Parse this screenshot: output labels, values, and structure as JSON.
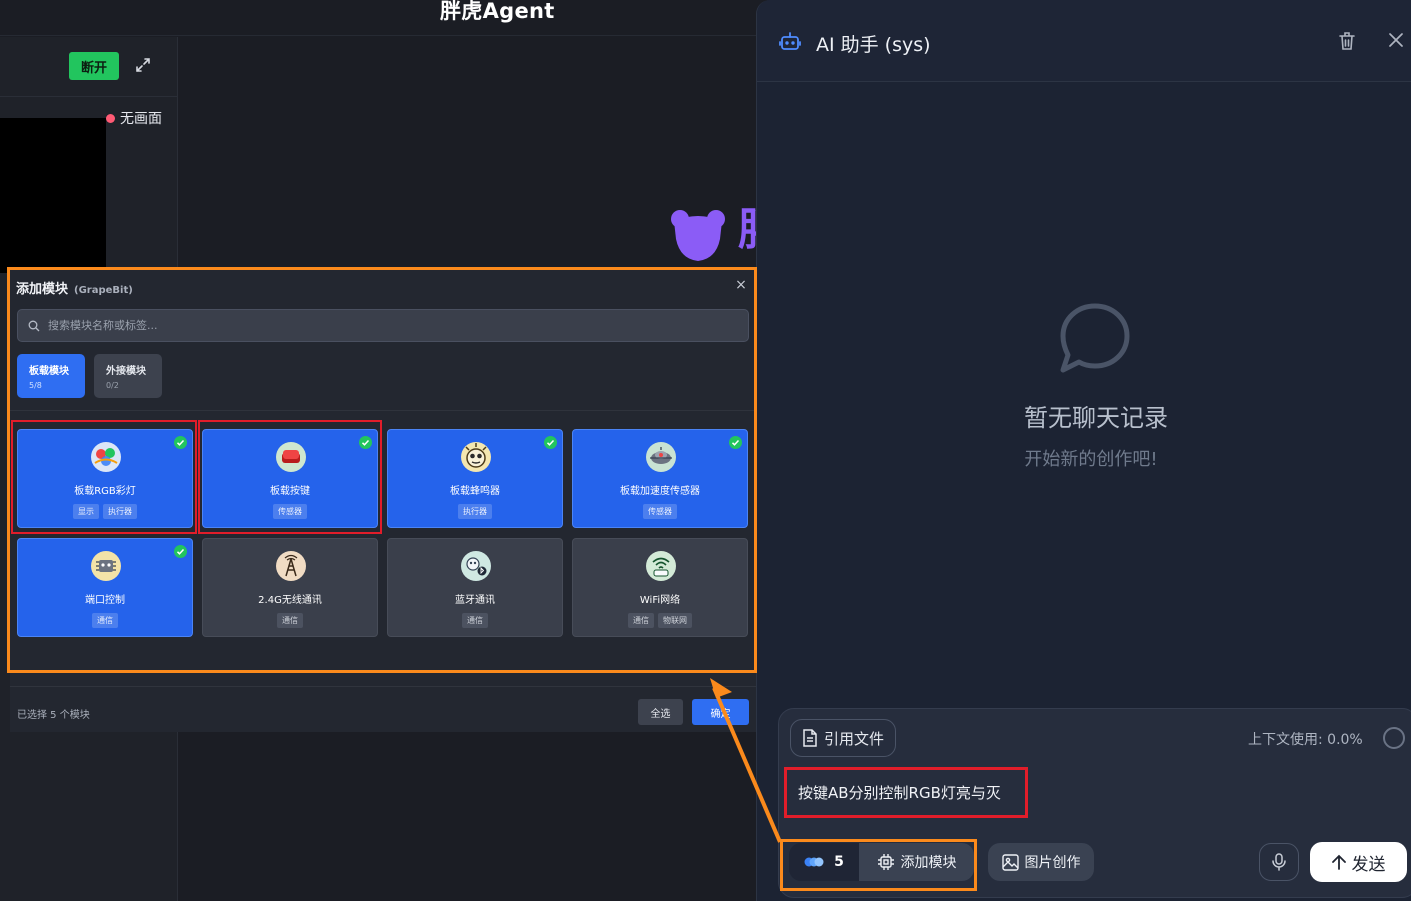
{
  "app": {
    "title": "胖虎Agent",
    "brand_peek": "胖"
  },
  "left_panel": {
    "disconnect_label": "断开",
    "stream_status": "无画面"
  },
  "modal": {
    "title": "添加模块",
    "subtitle": "(GrapeBit)",
    "close_glyph": "×",
    "search_placeholder": "搜索模块名称或标签...",
    "tabs": [
      {
        "label": "板载模块",
        "count": "5/8",
        "active": true
      },
      {
        "label": "外接模块",
        "count": "0/2",
        "active": false
      }
    ],
    "modules": [
      {
        "name": "板载RGB彩灯",
        "tags": [
          "显示",
          "执行器"
        ],
        "selected": true,
        "icon": "rgb-light-icon"
      },
      {
        "name": "板载按键",
        "tags": [
          "传感器"
        ],
        "selected": true,
        "icon": "button-icon"
      },
      {
        "name": "板载蜂鸣器",
        "tags": [
          "执行器"
        ],
        "selected": true,
        "icon": "buzzer-icon"
      },
      {
        "name": "板载加速度传感器",
        "tags": [
          "传感器"
        ],
        "selected": true,
        "icon": "accelerometer-icon"
      },
      {
        "name": "端口控制",
        "tags": [
          "通信"
        ],
        "selected": true,
        "icon": "port-icon"
      },
      {
        "name": "2.4G无线通讯",
        "tags": [
          "通信"
        ],
        "selected": false,
        "icon": "wireless-icon"
      },
      {
        "name": "蓝牙通讯",
        "tags": [
          "通信"
        ],
        "selected": false,
        "icon": "bluetooth-icon"
      },
      {
        "name": "WiFi网络",
        "tags": [
          "通信",
          "物联网"
        ],
        "selected": false,
        "icon": "wifi-icon"
      }
    ],
    "footer": {
      "selected_text": "已选择 5 个模块",
      "select_all_label": "全选",
      "confirm_label": "确定"
    }
  },
  "assistant": {
    "title": "AI 助手 (sys)",
    "empty_title": "暂无聊天记录",
    "empty_subtitle": "开始新的创作吧!",
    "cite_file_label": "引用文件",
    "context_usage": "上下文使用:  0.0%",
    "prompt": "按键AB分别控制RGB灯亮与灭",
    "module_count": "5",
    "add_module_label": "添加模块",
    "image_create_label": "图片创作",
    "send_label": "发送"
  },
  "colors": {
    "accent": "#2563eb",
    "success": "#22c55e",
    "highlight_orange": "#fb8a1c",
    "highlight_red": "#e11d2a",
    "brand_purple": "#8b5cf6"
  }
}
